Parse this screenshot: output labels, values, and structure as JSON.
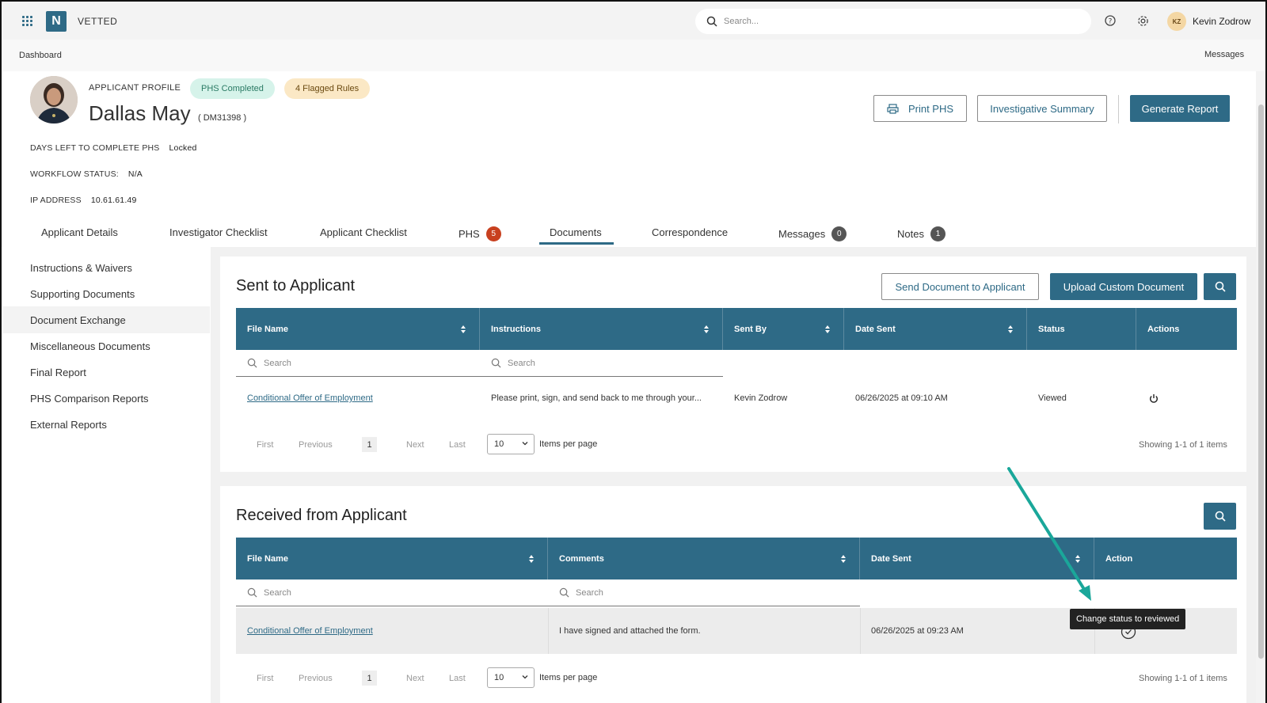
{
  "app": {
    "brand": "VETTED",
    "logo_letter": "N"
  },
  "topbar": {
    "search_placeholder": "Search...",
    "user_initials": "KZ",
    "user_name": "Kevin Zodrow"
  },
  "breadcrumb": {
    "current": "Dashboard",
    "messages": "Messages"
  },
  "profile": {
    "label": "APPLICANT PROFILE",
    "badge_completed": "PHS Completed",
    "badge_flagged": "4 Flagged Rules",
    "name": "Dallas May",
    "id": "( DM31398 )",
    "days_left_label": "DAYS LEFT TO COMPLETE PHS",
    "days_left_value": "Locked",
    "workflow_label": "WORKFLOW STATUS:",
    "workflow_value": "N/A",
    "ip_label": "IP ADDRESS",
    "ip_value": "10.61.61.49"
  },
  "actions": {
    "print": "Print PHS",
    "summary": "Investigative Summary",
    "generate": "Generate Report"
  },
  "tabs": [
    {
      "label": "Applicant Details"
    },
    {
      "label": "Investigator Checklist"
    },
    {
      "label": "Applicant Checklist"
    },
    {
      "label": "PHS",
      "count": "5"
    },
    {
      "label": "Documents"
    },
    {
      "label": "Correspondence"
    },
    {
      "label": "Messages",
      "count": "0"
    },
    {
      "label": "Notes",
      "count": "1"
    }
  ],
  "active_tab": "Documents",
  "sidebar": {
    "items": [
      {
        "label": "Instructions & Waivers"
      },
      {
        "label": "Supporting Documents"
      },
      {
        "label": "Document Exchange"
      },
      {
        "label": "Miscellaneous Documents"
      },
      {
        "label": "Final Report"
      },
      {
        "label": "PHS Comparison Reports"
      },
      {
        "label": "External Reports"
      }
    ],
    "active": "Document Exchange"
  },
  "sent": {
    "title": "Sent to Applicant",
    "send_button": "Send Document to Applicant",
    "upload_button": "Upload Custom Document",
    "columns": [
      "File Name",
      "Instructions",
      "Sent By",
      "Date Sent",
      "Status",
      "Actions"
    ],
    "search_placeholder": "Search",
    "rows": [
      {
        "file": "Conditional Offer of Employment",
        "instructions": "Please print, sign, and send back to me through your...",
        "sent_by": "Kevin Zodrow",
        "date": "06/26/2025 at 09:10 AM",
        "status": "Viewed"
      }
    ],
    "pager": {
      "first": "First",
      "previous": "Previous",
      "page": "1",
      "next": "Next",
      "last": "Last",
      "per_page": "10",
      "per_page_label": "Items per page",
      "showing": "Showing 1-1 of 1 items"
    }
  },
  "received": {
    "title": "Received from Applicant",
    "columns": [
      "File Name",
      "Comments",
      "Date Sent",
      "Action"
    ],
    "search_placeholder": "Search",
    "rows": [
      {
        "file": "Conditional Offer of Employment",
        "comments": "I have signed and attached the form.",
        "date": "06/26/2025 at 09:23 AM"
      }
    ],
    "tooltip": "Change status to reviewed",
    "pager": {
      "first": "First",
      "previous": "Previous",
      "page": "1",
      "next": "Next",
      "last": "Last",
      "per_page": "10",
      "per_page_label": "Items per page",
      "showing": "Showing 1-1 of 1 items"
    }
  },
  "colors": {
    "primary": "#2e6a86",
    "badge_red": "#c8401f",
    "badge_gray": "#555555",
    "annotation_arrow": "#1aa79a"
  }
}
